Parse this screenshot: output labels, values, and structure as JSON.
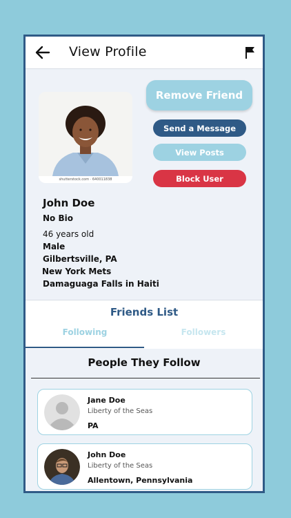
{
  "header": {
    "title": "View Profile",
    "back_icon": "back-arrow-icon",
    "report_icon": "flag-icon"
  },
  "profile": {
    "photo_caption": "shutterstock.com · 640011838",
    "name": "John Doe",
    "bio": "No Bio",
    "age": "46 years old",
    "details": [
      "Male",
      "Gilbertsville, PA",
      "New York Mets",
      "Damaguaga Falls in Haiti"
    ]
  },
  "actions": {
    "remove_friend": "Remove Friend",
    "send_message": "Send a Message",
    "view_posts": "View Posts",
    "block_user": "Block User"
  },
  "friends": {
    "title": "Friends List",
    "tabs": [
      {
        "label": "Following",
        "active": true
      },
      {
        "label": "Followers",
        "active": false
      }
    ],
    "section_title": "People They Follow",
    "people": [
      {
        "name": "Jane Doe",
        "ship": "Liberty of the Seas",
        "location": "PA",
        "avatar": "default-avatar-icon"
      },
      {
        "name": "John Doe",
        "ship": "Liberty of the Seas",
        "location": "Allentown, Pennsylvania",
        "avatar": "user-photo"
      }
    ]
  },
  "colors": {
    "background": "#8ecbdb",
    "primary": "#2f5a86",
    "accent": "#9dd2e2",
    "danger": "#d93545"
  }
}
